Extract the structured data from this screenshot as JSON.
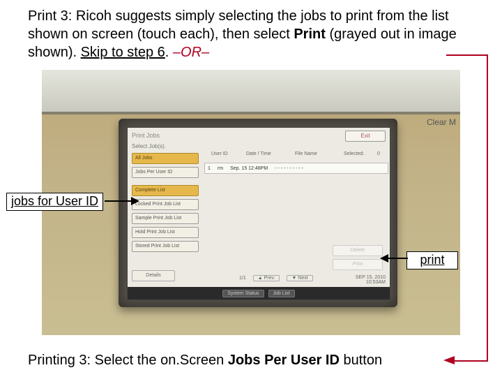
{
  "caption_top": {
    "prefix": "Print 3: Ricoh suggests simply selecting the jobs to print from the list shown on screen (touch each), then select ",
    "print_word": "Print",
    "mid": " (grayed out in image shown). ",
    "skip": "Skip to step 6",
    "period": ". ",
    "or": "–OR–"
  },
  "caption_bottom": {
    "prefix": "Printing 3: Select the on.Screen ",
    "bold": "Jobs Per User ID",
    "suffix": " button"
  },
  "callouts": {
    "jobs_for_user_id": "jobs for User ID",
    "print": "print"
  },
  "panel_label": "Clear M",
  "screen": {
    "title": "Print Jobs",
    "subtitle": "Select Job(s).",
    "exit": "Exit",
    "headers": {
      "user_id": "User ID",
      "date_time": "Date / Time",
      "file_name": "File Name",
      "selected": "Selected:",
      "selected_count": "0"
    },
    "left_buttons": {
      "all_jobs": "All Jobs",
      "jobs_per_user": "Jobs Per User ID",
      "complete_list": "Complete List",
      "locked_print": "Locked Print Job List",
      "sample_print": "Sample Print Job List",
      "hold_print": "Hold Print Job List",
      "stored_print": "Stored Print Job List"
    },
    "job_row": {
      "icon": "1",
      "user": "rm",
      "datetime": "Sep. 15 12:48PM",
      "filename": "- - - - - - - - - -"
    },
    "details": "Details",
    "pager": {
      "page": "1/1",
      "prev": "▲ Prev.",
      "next": "▼ Next"
    },
    "right_buttons": {
      "delete": "Delete",
      "print": "Print"
    },
    "bottom_bar": {
      "system_status": "System Status",
      "job_list": "Job List"
    },
    "timestamp": {
      "date": "SEP 15, 2010",
      "time": "10:53AM"
    }
  }
}
